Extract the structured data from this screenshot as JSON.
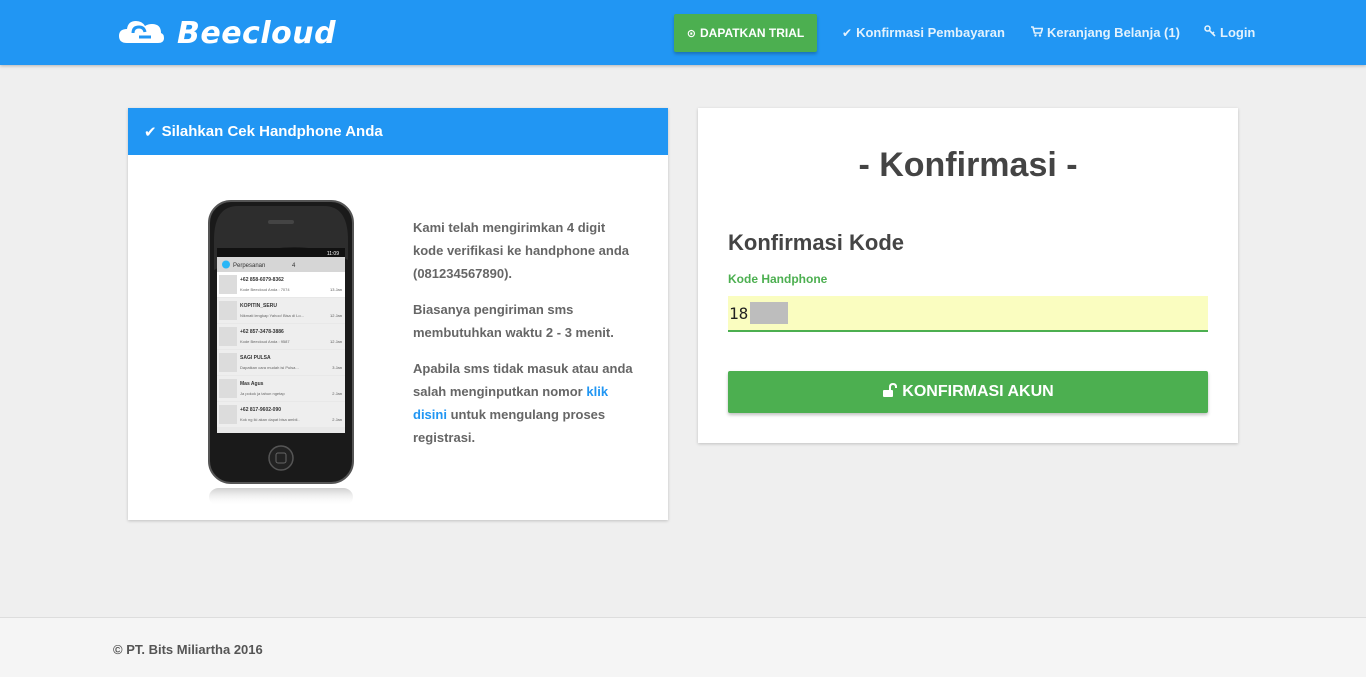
{
  "header": {
    "brand": "Beecloud",
    "trial_button": "DAPATKAN TRIAL",
    "nav": {
      "payment": "Konfirmasi Pembayaran",
      "cart": "Keranjang Belanja (1)",
      "login": "Login"
    }
  },
  "left_card": {
    "title": "Silahkan Cek Handphone Anda",
    "paragraph1": "Kami telah mengirimkan 4 digit kode verifikasi ke handphone anda (081234567890).",
    "paragraph2": "Biasanya pengiriman sms membutuhkan waktu 2 - 3 menit.",
    "paragraph3_before": "Apabila sms tidak masuk atau anda salah menginputkan nomor ",
    "paragraph3_link": "klik disini",
    "paragraph3_after": " untuk mengulang proses registrasi.",
    "phone": {
      "status_time": "11:09",
      "app_title": "Perpesanan",
      "count": "4",
      "messages": [
        {
          "sender": "+62 858-6079-8362",
          "preview": "Kode Beecloud Anda : 7074",
          "date": "13 Jan"
        },
        {
          "sender": "KOPITIN_SERU",
          "preview": "Nikmati lengkap Yahoo! Bisa di Lo...",
          "date": "12 Jan"
        },
        {
          "sender": "+62 857-3478-3886",
          "preview": "Kode Beecloud Anda : 9587",
          "date": "12 Jan"
        },
        {
          "sender": "SAGI PULSA",
          "preview": "Dapatkan cara mudah isi Pulsa...",
          "date": "3 Jan"
        },
        {
          "sender": "Mas Agus",
          "preview": "Ja pokok ja tahun ngetap",
          "date": "2 Jan"
        },
        {
          "sender": "+62 817-9602-090",
          "preview": "Kok ng iki akan dapat bisa ambil..",
          "date": "2 Jan"
        }
      ]
    }
  },
  "right_card": {
    "title": "- Konfirmasi -",
    "subtitle": "Konfirmasi Kode",
    "field_label": "Kode Handphone",
    "field_value": "18",
    "confirm_button": "KONFIRMASI AKUN"
  },
  "footer": {
    "text": "© PT. Bits Miliartha 2016"
  },
  "colors": {
    "primary": "#2196f3",
    "success": "#4caf50",
    "field_bg": "#fafdc0",
    "page_bg": "#efefef"
  },
  "icons": {
    "brand": "cloud-icon",
    "trial": "clock-icon",
    "payment": "check-icon",
    "cart": "cart-icon",
    "login": "key-icon",
    "card_title": "check-icon",
    "confirm": "unlock-icon"
  }
}
